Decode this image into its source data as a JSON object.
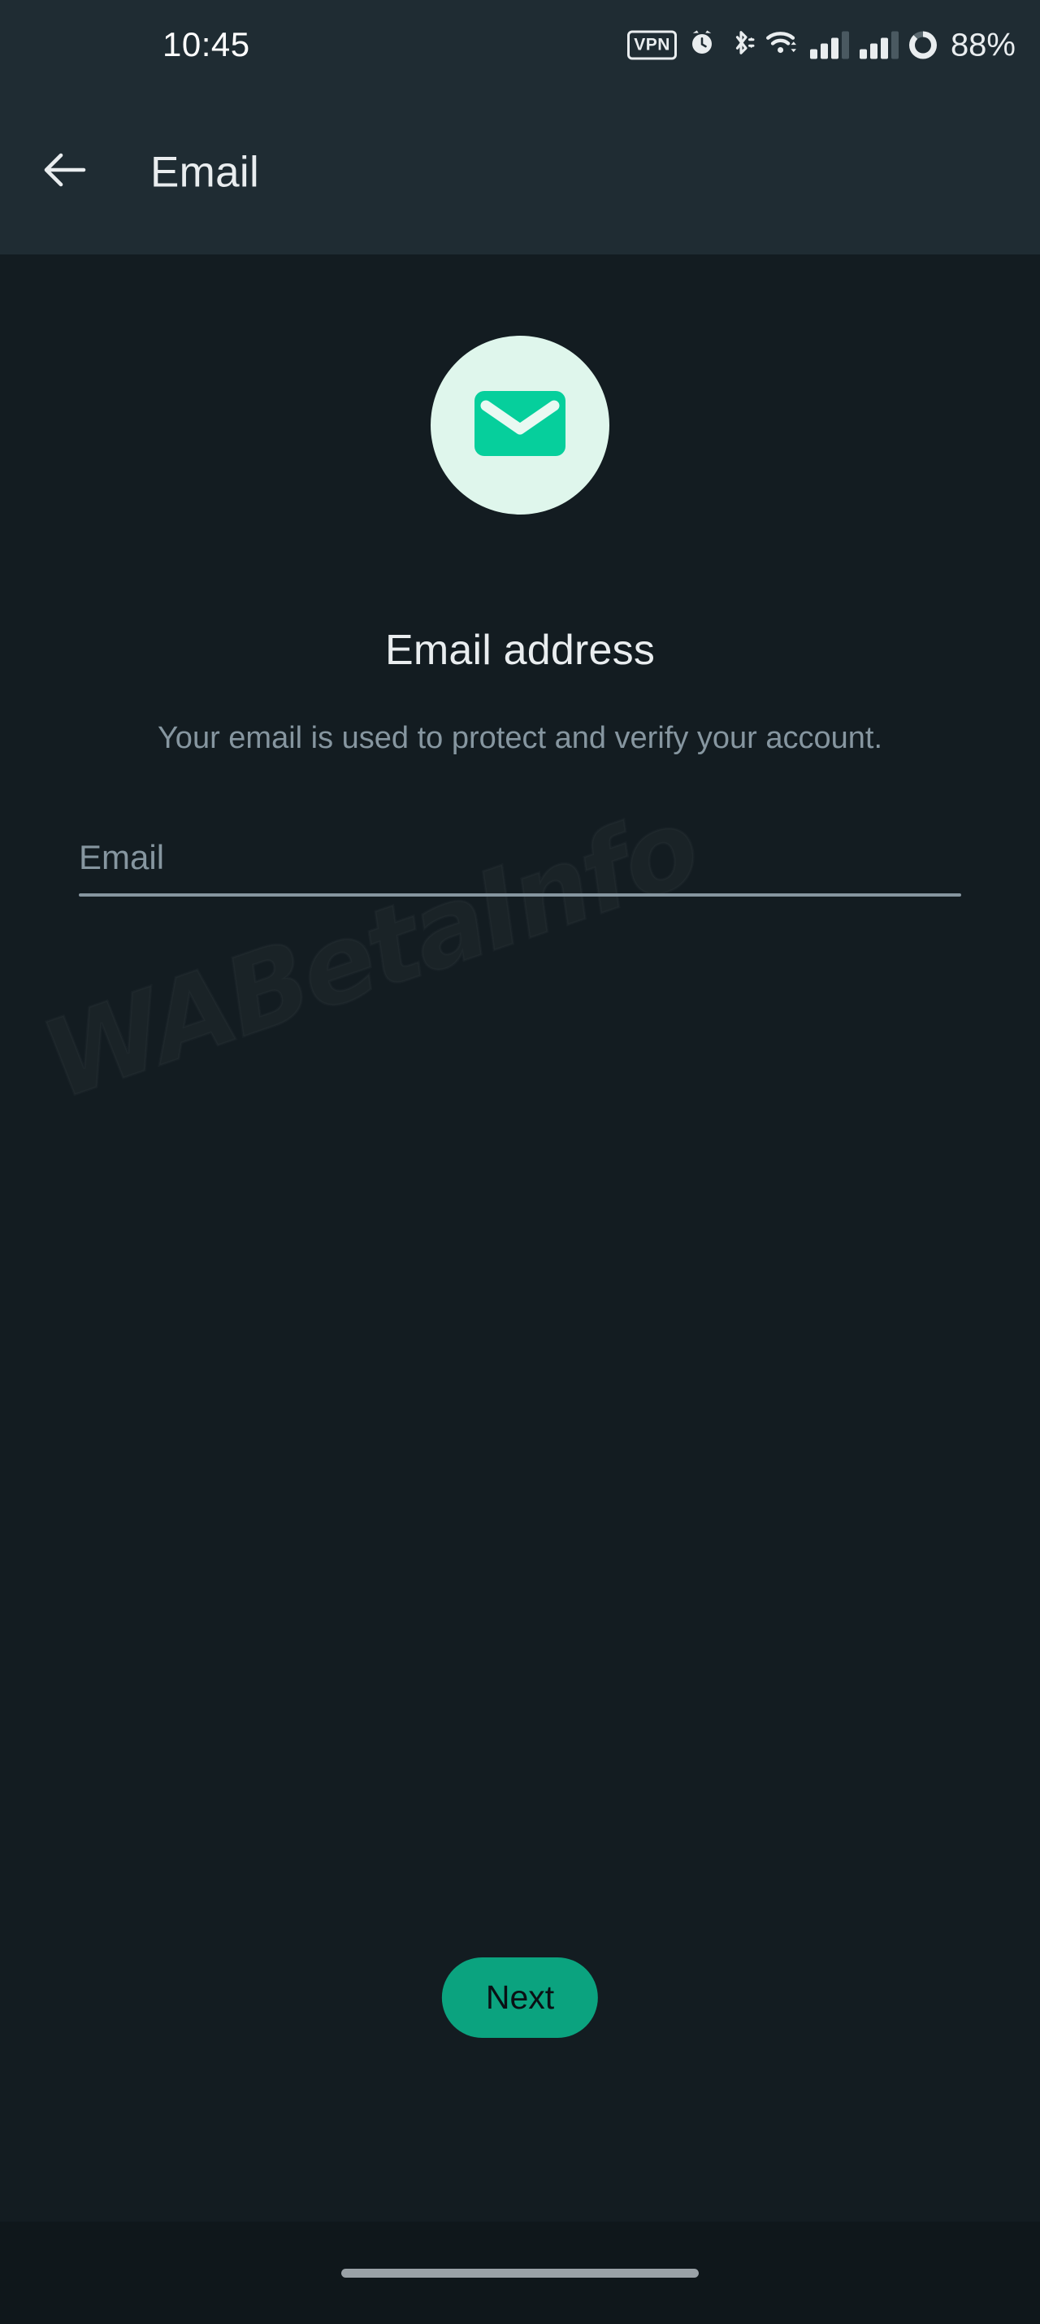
{
  "status_bar": {
    "clock": "10:45",
    "battery_percent": "88%",
    "battery_level": 88,
    "icons": [
      "vpn-badge-icon",
      "alarm-clock-icon",
      "bluetooth-icon",
      "wifi-icon",
      "cellular-signal-1-icon",
      "cellular-signal-2-icon",
      "battery-ring-icon"
    ],
    "vpn_label": "VPN"
  },
  "app_bar": {
    "back_icon": "arrow-left-icon",
    "title": "Email"
  },
  "main": {
    "hero_icon": "envelope-icon",
    "headline": "Email address",
    "subtext": "Your email is used to protect and verify your account.",
    "email_field": {
      "label": "Email",
      "placeholder": "Email",
      "value": ""
    },
    "primary_action": "Next"
  },
  "watermark": {
    "text": "WABetaInfo"
  },
  "nav_bar": {
    "handle": "home-gesture-handle"
  },
  "colors": {
    "app_bar_bg": "#1f2c33",
    "content_bg": "#131c21",
    "nav_bar_bg": "#0f171b",
    "accent_green": "#0ba37f",
    "icon_green": "#06cf9c",
    "icon_circle_bg": "#dff6ec",
    "primary_text": "#e9edef",
    "secondary_text": "#8696a0"
  }
}
